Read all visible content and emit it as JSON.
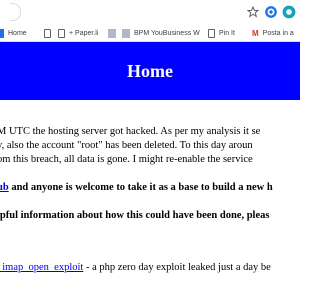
{
  "browser": {
    "bookmarks": [
      {
        "label": "Home",
        "icon": "home-doc-icon"
      },
      {
        "label": "",
        "icon": "page-icon"
      },
      {
        "label": "+ Paper.li",
        "icon": "page-icon"
      },
      {
        "label": "",
        "icon": "bookmark-icon"
      },
      {
        "label": "BPM YouBusiness W",
        "icon": "bookmark-icon"
      },
      {
        "label": "Pin It",
        "icon": "page-icon"
      },
      {
        "label": "Posta in a",
        "icon": "gmail-icon"
      }
    ]
  },
  "page": {
    "title": "Home",
    "line1": "M UTC the hosting server got hacked. As per my analysis it se",
    "line2": "y, also the account \"root\" has been deleted. To this day aroun",
    "line3": "om this breach, all data is gone. I might re-enable the service",
    "line4_link": "ub",
    "line4_text": " and anyone is welcome to take it as a base to build a new h",
    "line5": "lpful information about how this could have been done, pleas",
    "line6_link": "_imap_open_exploit",
    "line6_text": " - a php zero day exploit leaked just a day be"
  },
  "colors": {
    "header_bg": "#0000ff",
    "link": "#0000ee"
  }
}
